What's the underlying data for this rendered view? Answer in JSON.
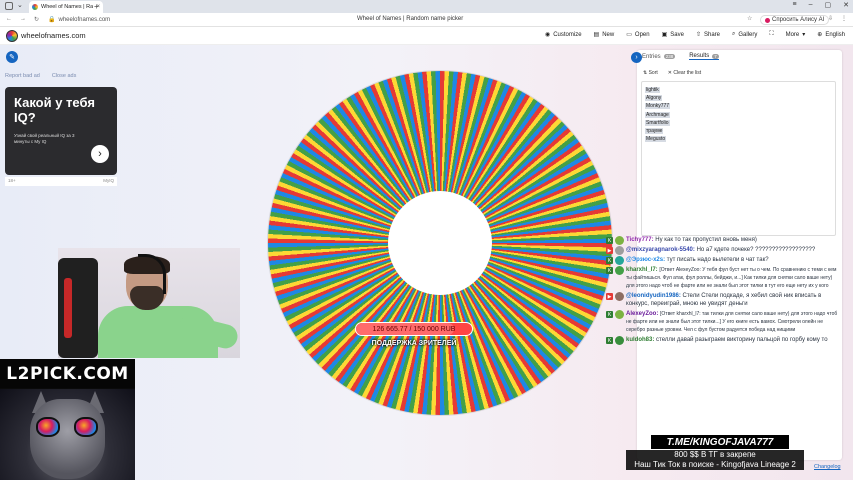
{
  "browser": {
    "tab_title": "Wheel of Names | Rand",
    "url": "wheelofnames.com",
    "page_title": "Wheel of Names | Random name picker",
    "alisa_label": "Спросить Алису AI"
  },
  "app": {
    "site_name": "wheelofnames.com",
    "menu": [
      {
        "label": "Customize",
        "icon": "palette-icon"
      },
      {
        "label": "New",
        "icon": "file-icon"
      },
      {
        "label": "Open",
        "icon": "folder-icon"
      },
      {
        "label": "Save",
        "icon": "save-icon"
      },
      {
        "label": "Share",
        "icon": "share-icon"
      },
      {
        "label": "Gallery",
        "icon": "search-icon"
      },
      {
        "label": "",
        "icon": "fullscreen-icon"
      },
      {
        "label": "More",
        "icon": "chevron-down-icon"
      },
      {
        "label": "English",
        "icon": "globe-icon"
      }
    ]
  },
  "ad": {
    "report_label": "Report bad ad",
    "close_label": "Close ads",
    "headline": "Какой у тебя IQ?",
    "subtext": "Узнай свой реальный IQ за 3 минуты с My IQ",
    "footer_left": "18+",
    "footer_right": "MyIQ"
  },
  "wheel": {
    "progress_text": "126 665.77 / 150 000 RUB",
    "progress_fraction": 0.8444,
    "progress_label": "ПОДДЕРЖКА ЗРИТЕЛЕЙ",
    "colors": [
      "#e53935",
      "#fdd835",
      "#43a047",
      "#1e88e5"
    ]
  },
  "panel": {
    "tabs": [
      {
        "label": "Entries",
        "badge": "238"
      },
      {
        "label": "Results",
        "badge": "7"
      }
    ],
    "sort_label": "Sort",
    "clear_label": "Clear the list",
    "results": [
      "lightik",
      "Algony",
      "Monky777",
      "Archmage",
      "Smartfolio",
      "трауме",
      "Megusto"
    ],
    "changelog": "Changelog"
  },
  "overlay": {
    "brand": "L2PICK.COM",
    "tg_handle": "T.ME/KINGOFJAVA777",
    "line1": "800 $$  В ТГ в закрепе",
    "line2": "Наш Тик Ток в поиске - Kingofjava Lineage 2"
  },
  "chat": [
    {
      "src": "K",
      "user": "Tichy777:",
      "text": "Ну как то так пропустил вновь меня)"
    },
    {
      "src": "YT",
      "user": "@mixzyaragnarok-5540:",
      "text": "Но а7 кдете почеке? ??????????????????"
    },
    {
      "src": "K",
      "user": "@Эрзюс-х2s:",
      "text": "тут писать надо вылетели в чат так?"
    },
    {
      "src": "K",
      "user": "kharxhl_l7:",
      "text": "[Ответ AlexeyZoo: У тебя фул буст нет ты о чем. По сравнению с теми с кем ты файтишься. Фул атак, фул роллы, бейджи, и...] Как тилки для снятки сало ваше нету) для этого надо чтоб не фарте или не знали был этот тилки в тут его еще нету их у кого"
    },
    {
      "src": "YT",
      "user": "@leonidyudin1986:",
      "text": "Стели Стели подкаде, я хебил свой ник вписать в конкурс, переиграй, мною не увидят деньги"
    },
    {
      "src": "K",
      "user": "AlexeyZoo:",
      "text": "[Ответ kharxhl_l7: так тилки для снятки сало ваше нету) для этого надо чтоб не фарте или не знали был этот тилки...] У его книге есть вамох. Смотрели олейн не серебро разные уровни. Чел с фул бустом радуется победа над нищими"
    },
    {
      "src": "K",
      "user": "kuldoh83:",
      "text": "стелли давай разыграем викторину пальцой по горбу кому то"
    }
  ]
}
